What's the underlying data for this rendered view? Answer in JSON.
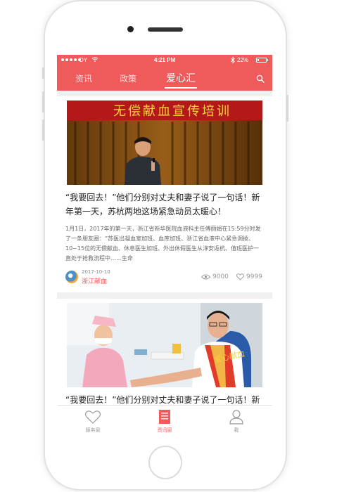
{
  "status_bar": {
    "carrier": "DY",
    "time": "4:21 PM",
    "battery_percent": "22%",
    "battery_level": 0.22,
    "icons": [
      "signal-dots-icon",
      "wifi-icon",
      "bluetooth-icon",
      "battery-icon"
    ]
  },
  "header": {
    "tabs": [
      {
        "label": "资讯",
        "active": false
      },
      {
        "label": "政策",
        "active": false
      },
      {
        "label": "爱心汇",
        "active": true
      }
    ],
    "search_icon": "search-icon"
  },
  "feed": {
    "articles": [
      {
        "banner_text": "无偿献血宣传培训",
        "title": "“我要回去！”他们分别对丈夫和妻子说了一句话！新年第一天，苏杭两地这场紧急动员太暖心！",
        "excerpt": "1月1日，2017年的第一天，浙江省新华医院血液科主任傅丽娟在15:59分时发了一条朋友圈：“苏医出凝血室加班、血库加班、浙江省血液中心紧急调拨、10~15位的无偿献血、休息医生加班、外出休假医生从淳安返杭、值班医护一直处于抢救流程中……生命",
        "date": "2017-10-10",
        "source": "浙江献血",
        "views": "9000",
        "likes": "9999"
      },
      {
        "sash_text": "爱心献血",
        "title": "“我要回去！”他们分别对丈夫和妻子说了一句话！新年第一天，苏杭两地这场紧急动员太暖心！"
      }
    ]
  },
  "bottom_nav": {
    "items": [
      {
        "label": "服务窗",
        "icon": "heart-icon",
        "active": false
      },
      {
        "label": "资讯窗",
        "icon": "document-icon",
        "active": true
      },
      {
        "label": "我",
        "icon": "user-icon",
        "active": false
      }
    ]
  },
  "colors": {
    "accent": "#ef5a5a",
    "text": "#222222",
    "muted": "#999999"
  }
}
